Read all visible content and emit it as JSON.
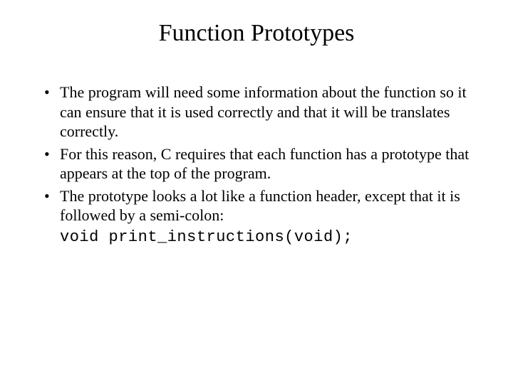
{
  "title": "Function Prototypes",
  "bullets": [
    "The program will need some information about the function so it can ensure that it is used correctly and that it will be translates correctly.",
    "For this reason, C requires that each function has a prototype that appears at the top of the program.",
    "The prototype looks a lot like a function header, except that it is followed by a semi-colon:"
  ],
  "code": "void print_instructions(void);"
}
